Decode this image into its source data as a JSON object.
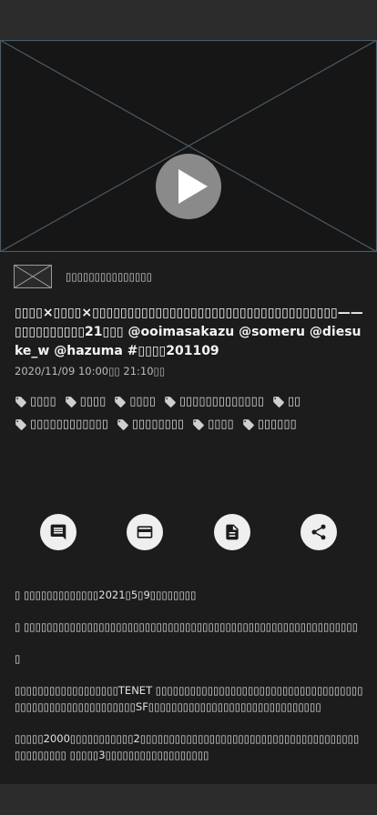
{
  "video": {
    "play_icon": "play-icon"
  },
  "channel": {
    "thumbnail_icon": "placeholder-image-icon",
    "name": "▯▯▯▯▯▯▯▯▯▯▯▯▯▯▯"
  },
  "program": {
    "title": "▯▯▯▯×▯▯▯▯×▯▯▯▯▯▯▯▯▯▯▯▯▯▯▯▯▯▯▯▯▯▯▯▯▯▯▯▯▯▯▯▯▯▯▯——▯▯▯▯▯▯▯▯▯▯21▯▯▯ @ooimasakazu @someru @diesuke_w @hazuma #▯▯▯▯201109",
    "date": "2020/11/09 10:00▯▯ 21:10▯▯"
  },
  "tags": [
    "▯▯▯▯",
    "▯▯▯▯",
    "▯▯▯▯",
    "▯▯▯▯▯▯▯▯▯▯▯▯▯",
    "▯▯",
    "▯▯▯▯▯▯▯▯▯▯▯▯",
    "▯▯▯▯▯▯▯▯",
    "▯▯▯▯",
    "▯▯▯▯▯▯"
  ],
  "actions": [
    {
      "name": "comment-button",
      "icon": "comment-icon"
    },
    {
      "name": "card-button",
      "icon": "card-icon"
    },
    {
      "name": "document-button",
      "icon": "document-icon"
    },
    {
      "name": "share-button",
      "icon": "share-icon"
    }
  ],
  "description": [
    "▯ ▯▯▯▯▯▯▯▯▯▯▯▯▯2021▯5▯9▯▯▯▯▯▯▯▯",
    "▯ ▯▯▯▯▯▯▯▯▯▯▯▯▯▯▯▯▯▯▯▯▯▯▯▯▯▯▯▯▯▯▯▯▯▯▯▯▯▯▯▯▯▯▯▯▯▯▯▯▯▯▯▯▯▯▯▯▯▯",
    "▯",
    "▯▯▯▯▯▯▯▯▯▯▯▯▯▯▯▯▯▯TENET ▯▯▯▯▯▯▯▯▯▯▯▯▯▯▯▯▯▯▯▯▯▯▯▯▯▯▯▯▯▯▯▯▯▯▯▯▯▯▯▯▯▯▯▯▯▯▯▯▯▯▯▯▯▯▯▯▯SF▯▯▯▯▯▯▯▯▯▯▯▯▯▯▯▯▯▯▯▯▯▯▯▯▯▯▯▯▯▯",
    "▯▯▯▯▯2000▯▯▯▯▯▯▯▯▯▯▯2▯▯▯▯▯▯▯▯▯▯▯▯▯▯▯▯▯▯▯▯▯▯▯▯▯▯▯▯▯▯▯▯▯▯▯▯▯▯▯▯▯▯▯▯▯▯▯ ▯▯▯▯▯3▯▯▯▯▯▯▯▯▯▯▯▯▯▯▯▯▯▯"
  ],
  "colors": {
    "background": "#1c1c1c",
    "bar": "#2c2c2c",
    "button": "#efefef",
    "placeholder_lines": "#4a5a66"
  }
}
